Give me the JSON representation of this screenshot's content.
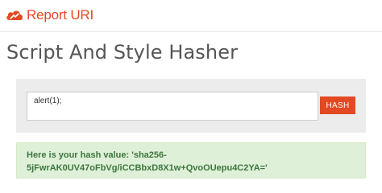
{
  "brand": {
    "name": "Report URI",
    "color": "#e24a23"
  },
  "page": {
    "title": "Script And Style Hasher"
  },
  "form": {
    "input_value": "alert(1);",
    "button_label": "HASH",
    "button_color": "#e24a23"
  },
  "result": {
    "message": "Here is your hash value: 'sha256-5jFwrAK0UV47oFbVg/iCCBbxD8X1w+QvoOUepu4C2YA='",
    "color": "#3c763d",
    "background": "#dff0d8"
  },
  "icons": {
    "logo": "cloud-logo-icon"
  }
}
